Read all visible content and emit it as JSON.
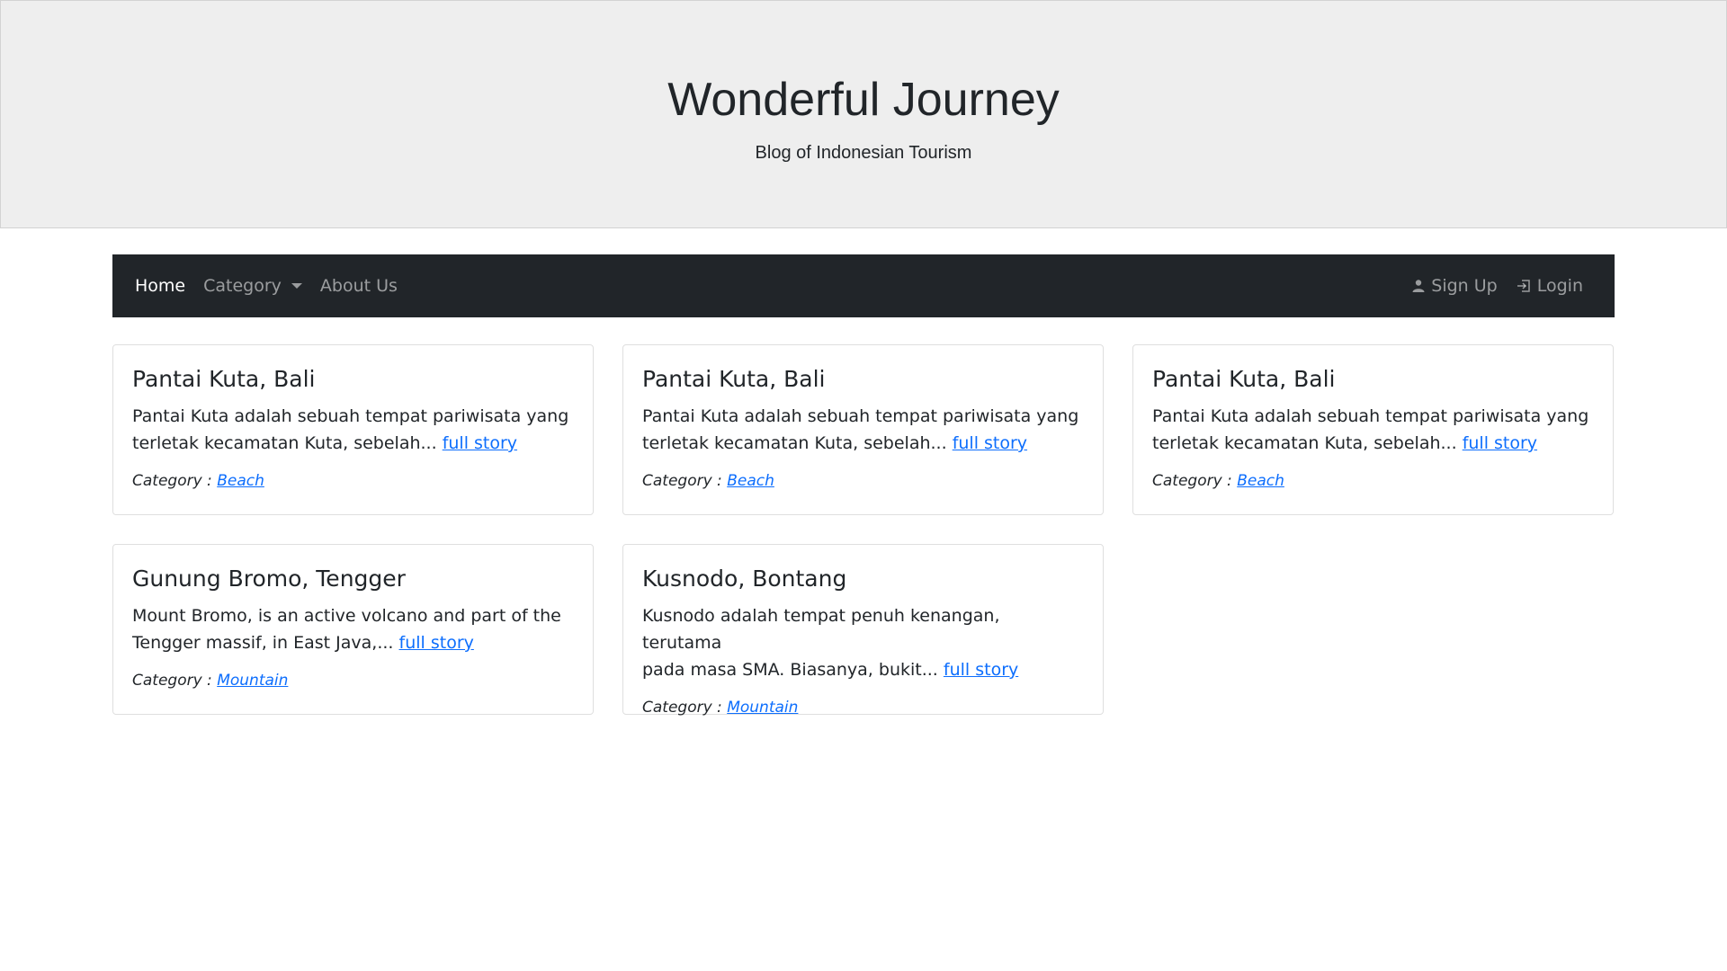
{
  "header": {
    "title": "Wonderful Journey",
    "subtitle": "Blog of Indonesian Tourism"
  },
  "nav": {
    "home": "Home",
    "category": "Category",
    "about": "About Us",
    "signup": "Sign Up",
    "login": "Login",
    "icons": {
      "signup": "user-icon",
      "login": "login-icon"
    }
  },
  "category_prefix": "Category :",
  "read_more": "full story",
  "cards": [
    {
      "title": "Pantai Kuta, Bali",
      "excerpt_line1": "Pantai Kuta adalah sebuah tempat pariwisata yang",
      "excerpt_line2": "terletak kecamatan Kuta, sebelah...",
      "category": "Beach"
    },
    {
      "title": "Pantai Kuta, Bali",
      "excerpt_line1": "Pantai Kuta adalah sebuah tempat pariwisata yang",
      "excerpt_line2": "terletak kecamatan Kuta, sebelah...",
      "category": "Beach"
    },
    {
      "title": "Pantai Kuta, Bali",
      "excerpt_line1": "Pantai Kuta adalah sebuah tempat pariwisata yang",
      "excerpt_line2": "terletak kecamatan Kuta, sebelah...",
      "category": "Beach"
    },
    {
      "title": "Gunung Bromo, Tengger",
      "excerpt_line1": "Mount Bromo, is an active volcano and part of the",
      "excerpt_line2": "Tengger massif, in East Java,...",
      "category": "Mountain"
    },
    {
      "title": "Kusnodo, Bontang",
      "excerpt_line1": "Kusnodo adalah tempat penuh kenangan, terutama",
      "excerpt_line2": "pada masa SMA. Biasanya, bukit...",
      "category": "Mountain"
    }
  ]
}
